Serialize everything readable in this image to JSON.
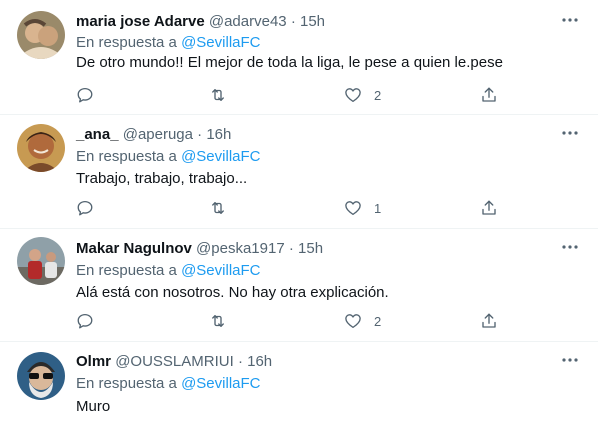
{
  "tweets": [
    {
      "name": "maria jose Adarve",
      "handle": "@adarve43",
      "dot": "·",
      "time": "15h",
      "reply_prefix": "En respuesta a ",
      "reply_to": "@SevillaFC",
      "text": "De otro mundo!! El mejor de toda la liga, le pese a quien le.pese",
      "likes": "2"
    },
    {
      "name": "_ana_",
      "handle": "@aperuga",
      "dot": "·",
      "time": "16h",
      "reply_prefix": "En respuesta a ",
      "reply_to": "@SevillaFC",
      "text": "Trabajo, trabajo, trabajo...",
      "likes": "1"
    },
    {
      "name": "Makar Nagulnov",
      "handle": "@peska1917",
      "dot": "·",
      "time": "15h",
      "reply_prefix": "En respuesta a ",
      "reply_to": "@SevillaFC",
      "text": "Alá está con nosotros. No hay otra explicación.",
      "likes": "2"
    },
    {
      "name": "Olmr",
      "handle": "@OUSSLAMRIUI",
      "dot": "·",
      "time": "16h",
      "reply_prefix": "En respuesta a ",
      "reply_to": "@SevillaFC",
      "text": "Muro",
      "likes": ""
    }
  ],
  "colors": {
    "text": "#0f1419",
    "secondary": "#536471",
    "link": "#1d9bf0",
    "divider": "#eff3f4"
  },
  "icons": {
    "reply": "reply-icon",
    "retweet": "retweet-icon",
    "like": "like-icon",
    "share": "share-icon",
    "more": "more-icon"
  }
}
